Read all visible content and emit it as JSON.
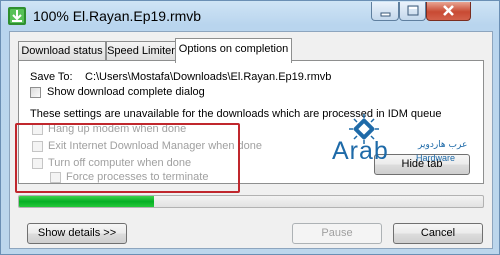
{
  "window": {
    "title": "100% El.Rayan.Ep19.rmvb"
  },
  "tabs": [
    {
      "label": "Download status",
      "active": false
    },
    {
      "label": "Speed Limiter",
      "active": false
    },
    {
      "label": "Options on completion",
      "active": true
    }
  ],
  "panel": {
    "save_to_label": "Save To:",
    "save_to_path": "C:\\Users\\Mostafa\\Downloads\\El.Rayan.Ep19.rmvb",
    "show_dialog_label": "Show download complete dialog",
    "show_dialog_checked": false,
    "notice": "These settings are unavailable for the downloads which are processed in IDM queue",
    "options": [
      {
        "label": "Hang up modem when done",
        "checked": false,
        "enabled": false
      },
      {
        "label": "Exit Internet Download Manager when done",
        "checked": false,
        "enabled": false
      },
      {
        "label": "Turn off computer when done",
        "checked": false,
        "enabled": false
      },
      {
        "label": "Force processes to terminate",
        "checked": false,
        "enabled": false
      }
    ],
    "hide_tab_label": "Hide tab"
  },
  "watermark": {
    "brand": "Arab",
    "sub": "Hardware",
    "arabic": "عرب هاردوير"
  },
  "progress": {
    "fraction": 0.29,
    "color": "#06b025"
  },
  "buttons": {
    "show_details": "Show details >>",
    "pause": "Pause",
    "cancel": "Cancel"
  },
  "colors": {
    "highlight_box": "#c0272d",
    "brand": "#1e6aa8"
  }
}
